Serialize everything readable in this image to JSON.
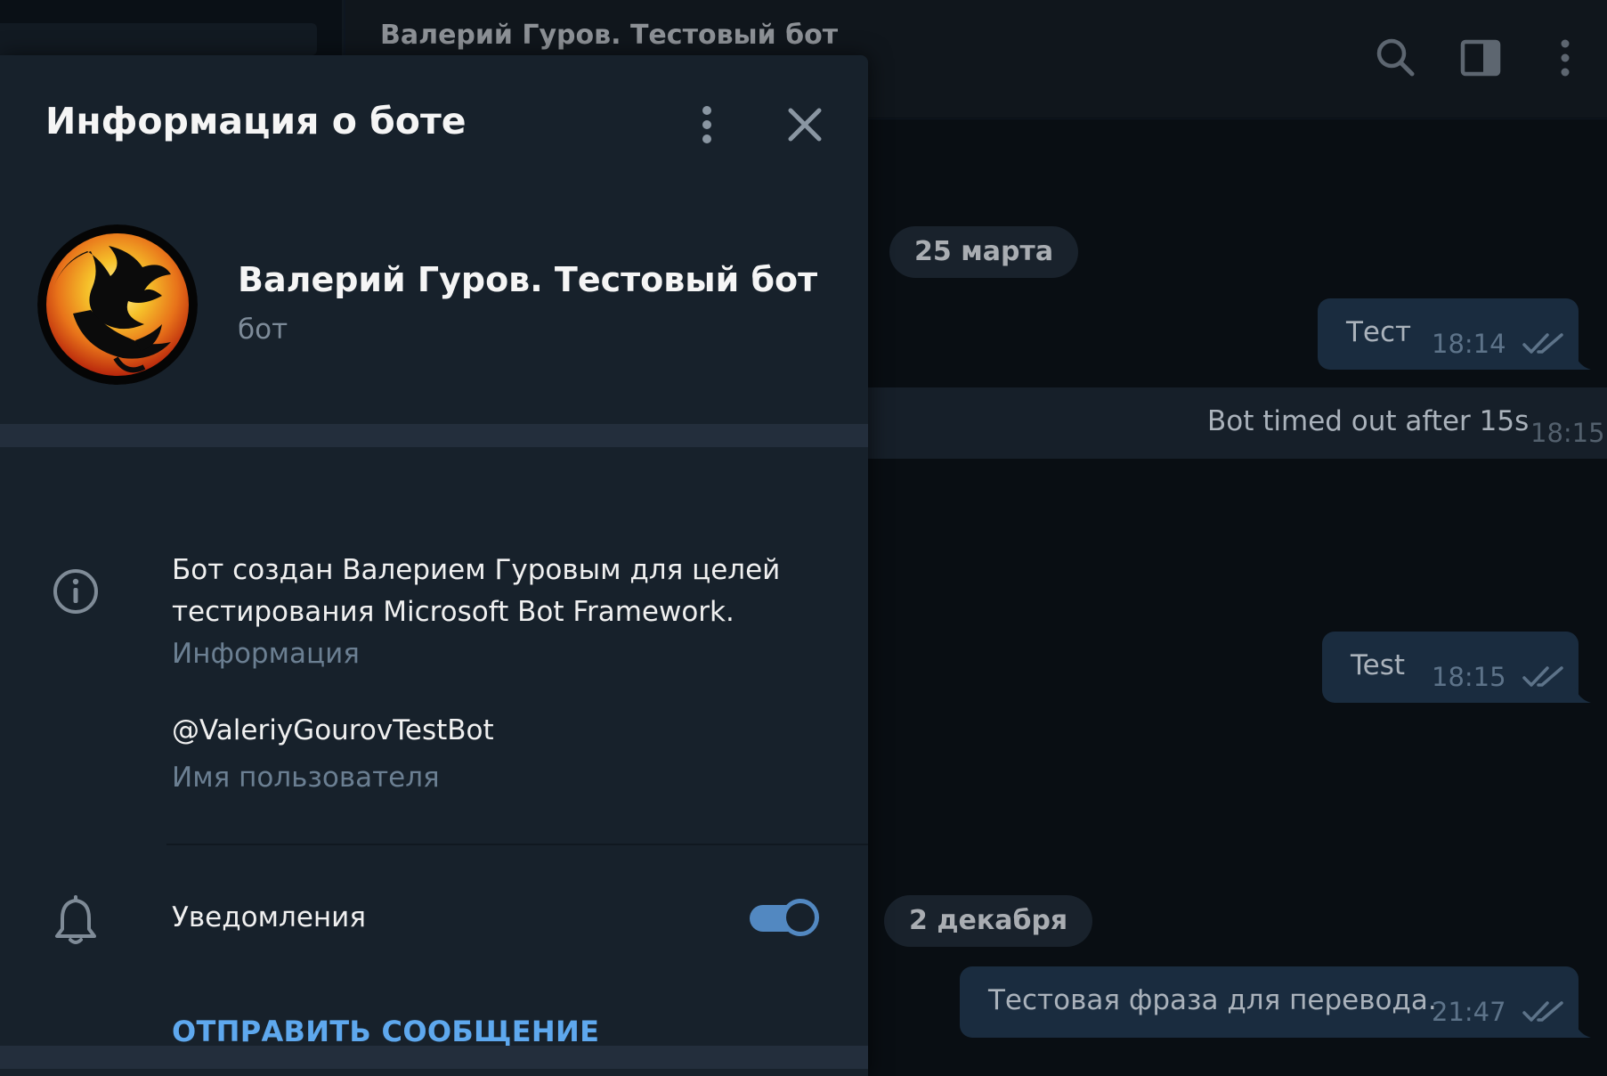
{
  "chat": {
    "header_title": "Валерий Гуров. Тестовый бот",
    "header_icons": [
      "search-icon",
      "sidebar-toggle-icon",
      "more-vertical-icon"
    ],
    "dates": [
      "25 марта",
      "2 декабря"
    ],
    "messages": [
      {
        "text": "Тест",
        "time": "18:14",
        "direction": "out",
        "status": "read"
      },
      {
        "text": "Bot timed out after 15s",
        "time": "18:15",
        "direction": "in"
      },
      {
        "text": "Test",
        "time": "18:15",
        "direction": "out",
        "status": "read"
      },
      {
        "text": "Тестовая фраза для перевода.",
        "time": "21:47",
        "direction": "out",
        "status": "read"
      }
    ]
  },
  "panel": {
    "title": "Информация о боте",
    "header_icons": [
      "more-vertical-icon",
      "close-icon"
    ],
    "bot_name": "Валерий Гуров. Тестовый бот",
    "bot_subtitle": "бот",
    "description": "Бот создан Валерием Гуровым для целей тестирования Microsoft Bot Framework.",
    "description_label": "Информация",
    "username": "@ValeriyGourovTestBot",
    "username_label": "Имя пользователя",
    "notifications_label": "Уведомления",
    "notifications_enabled": true,
    "send_message_label": "ОТПРАВИТЬ СООБЩЕНИЕ"
  },
  "colors": {
    "panel_bg": "#17212b",
    "accent": "#5288c1",
    "link": "#5ea8ee",
    "secondary_text": "#6b7f92"
  }
}
